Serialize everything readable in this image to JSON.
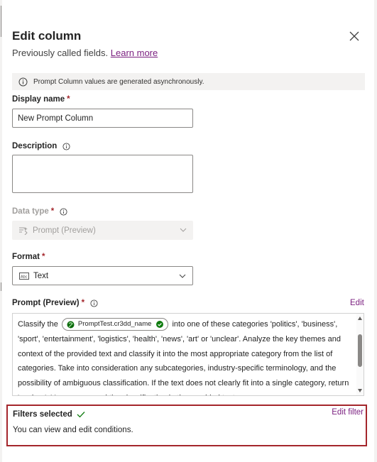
{
  "panel": {
    "title": "Edit column",
    "subtitle": "Previously called fields.",
    "learn_more": "Learn more"
  },
  "info_bar": {
    "text": "Prompt Column values are generated asynchronously.",
    "icon": "info-circle-icon"
  },
  "display_name": {
    "label": "Display name",
    "required_mark": "*",
    "value": "New Prompt Column"
  },
  "description": {
    "label": "Description",
    "value": ""
  },
  "data_type": {
    "label": "Data type",
    "required_mark": "*",
    "value": "Prompt (Preview)",
    "icon": "prompt-icon",
    "disabled": true
  },
  "format": {
    "label": "Format",
    "required_mark": "*",
    "value": "Text",
    "icon": "text-format-icon"
  },
  "prompt": {
    "label": "Prompt (Preview)",
    "required_mark": "*",
    "edit_label": "Edit",
    "text_before": "Classify the",
    "chip_label": "PromptTest.cr3dd_name",
    "text_after": "into one of these categories 'politics', 'business', 'sport', 'entertainment', 'logistics', 'health', 'news', 'art' or 'unclear'. Analyze the key themes and context of the provided text and classify it into the most appropriate category from the list of categories. Take into consideration any subcategories, industry-specific terminology, and the possibility of ambiguous classification. If the text does not clearly fit into a single category, return 'unclear'. You may ground the classification in the provided text."
  },
  "filters": {
    "title": "Filters selected",
    "description": "You can view and edit conditions.",
    "edit_label": "Edit filter"
  },
  "colors": {
    "accent_link": "#7a1e7f",
    "required": "#a4262c",
    "highlight_border": "#a4262c",
    "success": "#107c10"
  }
}
